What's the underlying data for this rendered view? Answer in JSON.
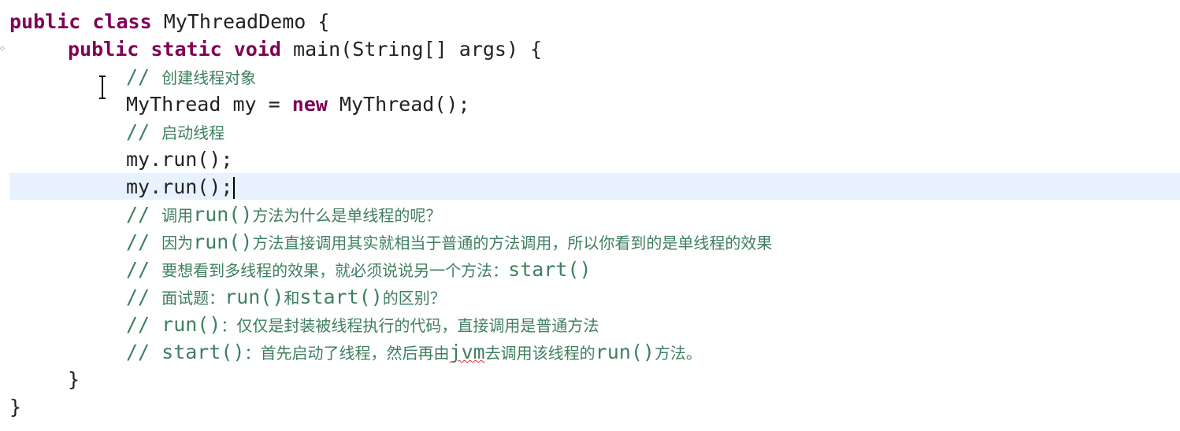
{
  "code": {
    "line1": {
      "kw1": "public",
      "kw2": "class",
      "rest": " MyThreadDemo {"
    },
    "line2": {
      "kw1": "public",
      "kw2": "static",
      "kw3": "void",
      "rest": " main(String[] args) {"
    },
    "line3": {
      "slashes": "// ",
      "text": "创建线程对象"
    },
    "line4": {
      "pre": "MyThread my = ",
      "kw": "new",
      "post": " MyThread();"
    },
    "line5": {
      "slashes": "// ",
      "text": "启动线程"
    },
    "line6": {
      "code": "my.run();"
    },
    "line7": {
      "code": "my.run();"
    },
    "line8": {
      "slashes": "// ",
      "a": "调用",
      "b": "run()",
      "c": "方法为什么是单线程的呢？"
    },
    "line9": {
      "slashes": "// ",
      "a": "因为",
      "b": "run()",
      "c": "方法直接调用其实就相当于普通的方法调用，所以你看到的是单线程的效果"
    },
    "line10": {
      "slashes": "// ",
      "a": "要想看到多线程的效果，就必须说说另一个方法：",
      "b": "start()"
    },
    "line11": {
      "slashes": "// ",
      "a": "面试题：",
      "b": "run()",
      "c": "和",
      "d": "start()",
      "e": "的区别？"
    },
    "line12": {
      "slashes": "// ",
      "b": "run()",
      "c": "：仅仅是封装被线程执行的代码，直接调用是普通方法"
    },
    "line13": {
      "slashes": "// ",
      "b": "start()",
      "c": "：首先启动了线程，然后再由",
      "d": "jvm",
      "e": "去调用该线程的",
      "f": "run()",
      "g": "方法。"
    },
    "line14": {
      "code": "}"
    },
    "line15": {
      "code": "}"
    }
  },
  "colors": {
    "keyword": "#7f0055",
    "comment": "#3f7f5f",
    "current_line": "#e8f2fe",
    "text": "#222222"
  }
}
